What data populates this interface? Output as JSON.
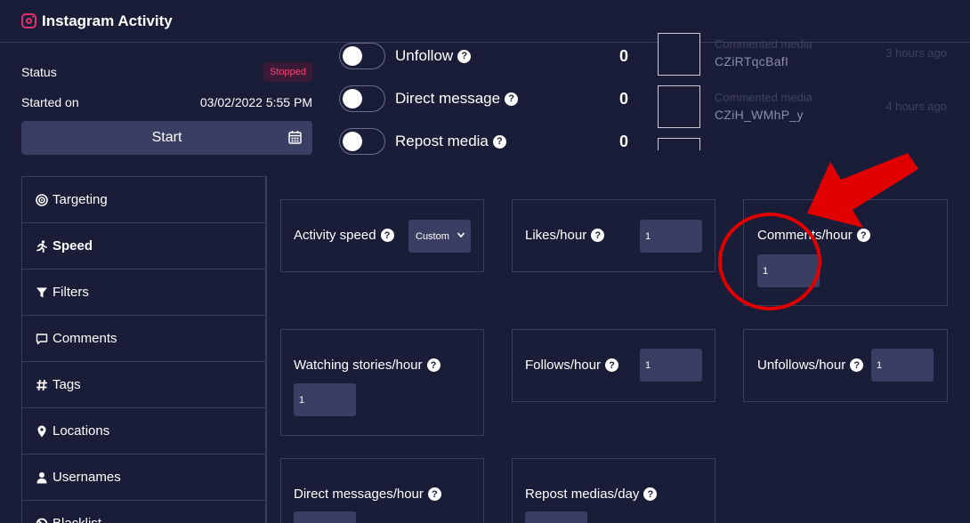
{
  "header": {
    "title": "Instagram Activity",
    "icon": "instagram-icon"
  },
  "status": {
    "status_label": "Status",
    "status_value": "Stopped",
    "started_label": "Started on",
    "started_value": "03/02/2022 5:55 PM",
    "start_button": "Start"
  },
  "toggles": [
    {
      "label": "Unfollow",
      "count": "0"
    },
    {
      "label": "Direct message",
      "count": "0"
    },
    {
      "label": "Repost media",
      "count": "0"
    }
  ],
  "feed": [
    {
      "type": "Commented media",
      "code": "CZiRTqcBafI",
      "time": "3 hours ago"
    },
    {
      "type": "Commented media",
      "code": "CZiH_WMhP_y",
      "time": "4 hours ago"
    }
  ],
  "sidebar": {
    "items": [
      {
        "label": "Targeting",
        "icon": "target-icon"
      },
      {
        "label": "Speed",
        "icon": "running-icon"
      },
      {
        "label": "Filters",
        "icon": "filter-icon"
      },
      {
        "label": "Comments",
        "icon": "comment-icon"
      },
      {
        "label": "Tags",
        "icon": "hashtag-icon"
      },
      {
        "label": "Locations",
        "icon": "map-pin-icon"
      },
      {
        "label": "Usernames",
        "icon": "user-icon"
      },
      {
        "label": "Blacklist",
        "icon": "ban-icon"
      }
    ]
  },
  "settings": {
    "activity_speed": {
      "label": "Activity speed",
      "value": "Custom"
    },
    "likes": {
      "label": "Likes/hour",
      "value": "1"
    },
    "comments": {
      "label": "Comments/hour",
      "value": "1"
    },
    "stories": {
      "label": "Watching stories/hour",
      "value": "1"
    },
    "follows": {
      "label": "Follows/hour",
      "value": "1"
    },
    "unfollows": {
      "label": "Unfollows/hour",
      "value": "1"
    },
    "direct_messages": {
      "label": "Direct messages/hour",
      "value": ""
    },
    "reposts": {
      "label": "Repost medias/day",
      "value": ""
    }
  },
  "colors": {
    "background": "#1a1d38",
    "input": "#3a3e63",
    "badge_text": "#f0467a",
    "annotation": "#e00000"
  }
}
